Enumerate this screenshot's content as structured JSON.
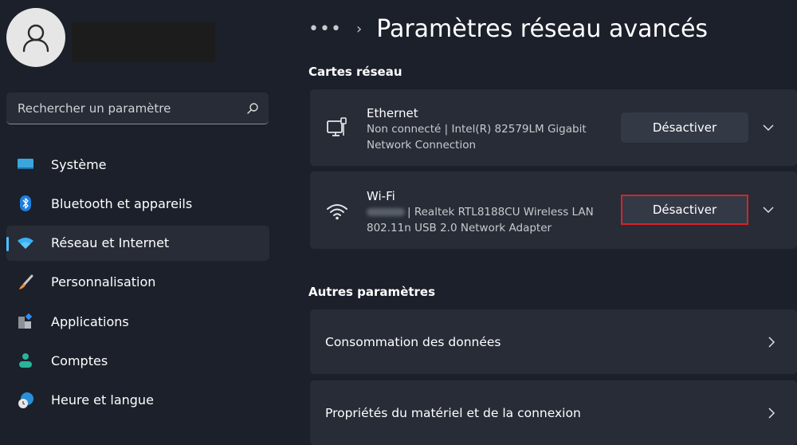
{
  "sidebar": {
    "avatar_icon": "person-icon",
    "user_name_redacted": true,
    "search": {
      "placeholder": "Rechercher un paramètre",
      "icon": "search-icon"
    },
    "items": [
      {
        "label": "Système",
        "icon": "monitor-icon",
        "active": false
      },
      {
        "label": "Bluetooth et appareils",
        "icon": "bluetooth-icon",
        "active": false
      },
      {
        "label": "Réseau et Internet",
        "icon": "wifi-icon",
        "active": true
      },
      {
        "label": "Personnalisation",
        "icon": "paintbrush-icon",
        "active": false
      },
      {
        "label": "Applications",
        "icon": "apps-icon",
        "active": false
      },
      {
        "label": "Comptes",
        "icon": "account-icon",
        "active": false
      },
      {
        "label": "Heure et langue",
        "icon": "globe-clock-icon",
        "active": false
      }
    ]
  },
  "header": {
    "more_label": "•••",
    "separator": "›",
    "title": "Paramètres réseau avancés"
  },
  "network_adapters": {
    "heading": "Cartes réseau",
    "adapters": [
      {
        "name": "Ethernet",
        "icon": "ethernet-icon",
        "status": "Non connecté",
        "description_line1": "Non connecté | Intel(R) 82579LM Gigabit",
        "description_line2": "Network Connection",
        "button_label": "Désactiver",
        "highlighted": false
      },
      {
        "name": "Wi-Fi",
        "icon": "wifi-icon",
        "status_redacted": true,
        "description_line1": "| Realtek RTL8188CU Wireless LAN",
        "description_line2": "802.11n USB 2.0 Network Adapter",
        "button_label": "Désactiver",
        "highlighted": true
      }
    ]
  },
  "other_settings": {
    "heading": "Autres paramètres",
    "items": [
      {
        "label": "Consommation des données"
      },
      {
        "label": "Propriétés du matériel et de la connexion"
      }
    ]
  },
  "colors": {
    "background": "#1b202a",
    "card": "#272c37",
    "button": "#343946",
    "accent": "#4cc2ff",
    "highlight_border": "#d8232a"
  }
}
